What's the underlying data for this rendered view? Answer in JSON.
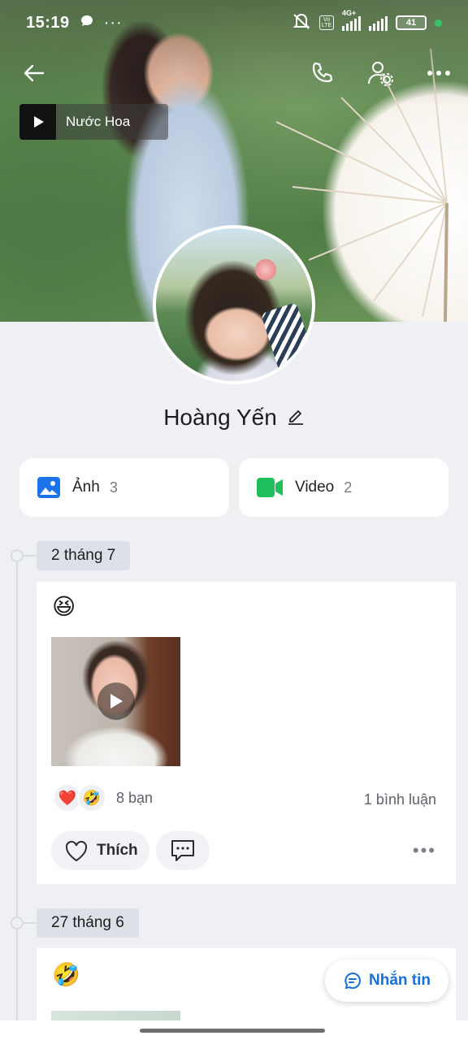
{
  "status_bar": {
    "time": "15:19",
    "network_tag_top": "4G+",
    "volte": "Vo LTE",
    "battery": "41"
  },
  "cover": {
    "music_title": "Nước Hoa"
  },
  "profile": {
    "name": "Hoàng Yến"
  },
  "media": [
    {
      "label": "Ảnh",
      "count": "3",
      "icon": "photo-icon",
      "color": "#1a73e8"
    },
    {
      "label": "Video",
      "count": "2",
      "icon": "video-camera-icon",
      "color": "#1fbf5b"
    }
  ],
  "posts": [
    {
      "date": "2 tháng 7",
      "emoji": "😆",
      "reactions": [
        "❤️",
        "🤣"
      ],
      "reaction_count": "8 bạn",
      "comments": "1 bình luận",
      "like_label": "Thích"
    },
    {
      "date": "27 tháng 6",
      "emoji": "🤣"
    }
  ],
  "chat_button": "Nhắn tin",
  "colors": {
    "accent": "#1a6fd6",
    "background": "#eef0f4"
  }
}
